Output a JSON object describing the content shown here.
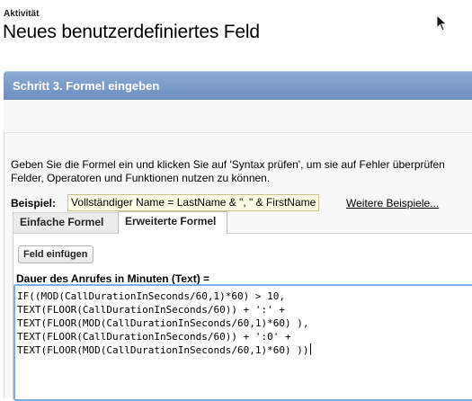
{
  "header": {
    "breadcrumb": "Aktivität",
    "title": "Neues benutzerdefiniertes Feld"
  },
  "section": {
    "title": "Schritt 3. Formel eingeben"
  },
  "instruction": {
    "line1": "Geben Sie die Formel ein und klicken Sie auf 'Syntax prüfen', um sie auf Fehler überprüfen",
    "line2": "Felder, Operatoren und Funktionen nutzen zu können."
  },
  "example": {
    "label": "Beispiel:",
    "value": "Vollständiger Name = LastName & \", \" & FirstName",
    "more_link": "Weitere Beispiele..."
  },
  "tabs": [
    {
      "label": "Einfache Formel",
      "active": false
    },
    {
      "label": "Erweiterte Formel",
      "active": true
    }
  ],
  "editor": {
    "insert_field_label": "Feld einfügen",
    "field_label": "Dauer des Anrufes in Minuten (Text) =",
    "lines": [
      "IF((MOD(CallDurationInSeconds/60,1)*60) > 10,",
      "TEXT(FLOOR(CallDurationInSeconds/60)) + ':' +",
      "TEXT(FLOOR(MOD(CallDurationInSeconds/60,1)*60) ),",
      "TEXT(FLOOR(CallDurationInSeconds/60)) + ':0' +",
      "TEXT(FLOOR(MOD(CallDurationInSeconds/60,1)*60) ))"
    ]
  },
  "colors": {
    "section_header": "#7a9bc8",
    "editor_focus_border": "#79aee8",
    "example_background": "#fdfce6"
  },
  "icons": {
    "cursor": "mouse-pointer-icon"
  }
}
